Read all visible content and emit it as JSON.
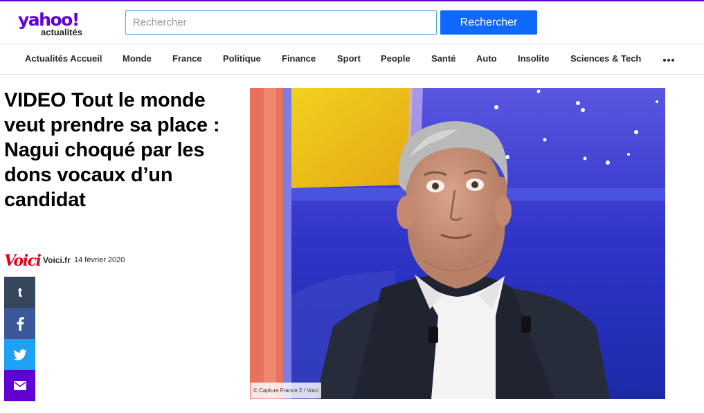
{
  "brand": {
    "logo_main": "yahoo!",
    "logo_sub": "actualités",
    "accent_color": "#6001d2"
  },
  "search": {
    "placeholder": "Rechercher",
    "value": "",
    "button_label": "Rechercher",
    "button_color": "#0f69ff"
  },
  "nav": {
    "items": [
      {
        "label": "Actualités Accueil"
      },
      {
        "label": "Monde"
      },
      {
        "label": "France"
      },
      {
        "label": "Politique"
      },
      {
        "label": "Finance"
      },
      {
        "label": "Sport"
      },
      {
        "label": "People"
      },
      {
        "label": "Santé"
      },
      {
        "label": "Auto"
      },
      {
        "label": "Insolite"
      },
      {
        "label": "Sciences & Tech"
      }
    ],
    "more_icon": "more-horizontal-icon"
  },
  "article": {
    "title": "VIDEO Tout le monde veut prendre sa place : Nagui choqué par les dons vocaux d’un candidat",
    "source_logo": "Voici",
    "source_name": "Voici.fr",
    "date": "14 février 2020",
    "image_caption": "© Capture France 2 / Voici"
  },
  "share": [
    {
      "icon": "tumblr-icon",
      "color": "#35465d"
    },
    {
      "icon": "facebook-icon",
      "color": "#3b5998"
    },
    {
      "icon": "twitter-icon",
      "color": "#1da1f2"
    },
    {
      "icon": "mail-icon",
      "color": "#6001d2"
    }
  ]
}
